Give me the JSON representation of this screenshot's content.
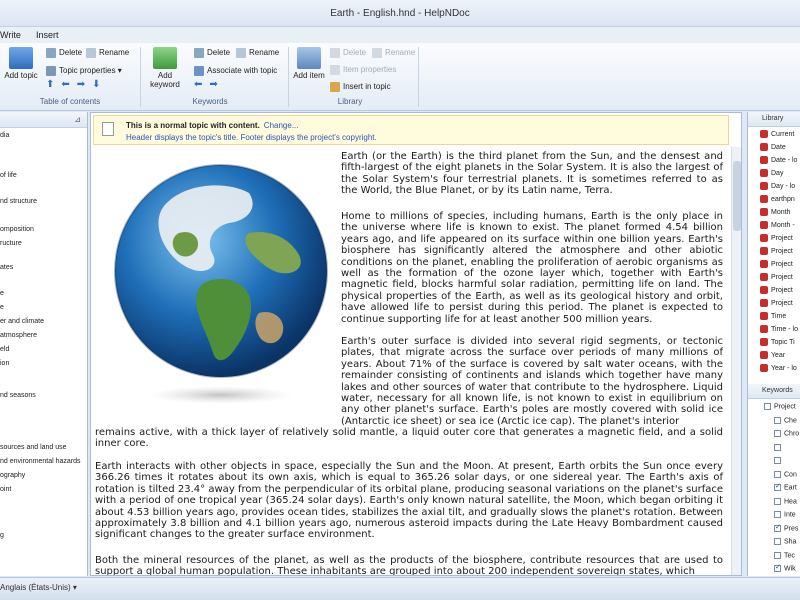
{
  "window": {
    "title": "Earth - English.hnd - HelpNDoc"
  },
  "menu": [
    "Write",
    "Insert"
  ],
  "ribbon": {
    "toc_group": {
      "label": "Table of contents",
      "add_topic": "Add topic",
      "delete": "Delete",
      "rename": "Rename",
      "topic_properties": "Topic properties"
    },
    "keywords_group": {
      "label": "Keywords",
      "add_keyword": "Add keyword",
      "delete": "Delete",
      "rename": "Rename",
      "associate": "Associate with topic"
    },
    "library_group": {
      "label": "Library",
      "add_item": "Add item",
      "delete": "Delete",
      "rename": "Rename",
      "item_properties": "Item properties",
      "insert_in_topic": "Insert in topic"
    }
  },
  "toc_items": [
    "dia",
    "of life",
    "nd structure",
    "omposition",
    "ructure",
    "ates",
    "e",
    "e",
    "er and climate",
    "atmosphere",
    "eld",
    "ion",
    "nd seasons",
    "sources and land use",
    "nd environmental hazards",
    "ography",
    "oint",
    "g"
  ],
  "editor": {
    "info_title": "This is a normal topic with content.",
    "info_link": "Change...",
    "info_desc": "Header displays the topic's title.  Footer displays the project's copyright."
  },
  "paragraphs": [
    "Earth (or the Earth) is the third planet from the Sun, and the densest and fifth-largest of the eight planets in the Solar System. It is also the largest of the Solar System's four terrestrial planets. It is sometimes referred to as the World, the Blue Planet, or by its Latin name, Terra.",
    "Home to millions of species, including humans, Earth is the only place in the universe where life is known to exist. The planet formed 4.54 billion years ago, and life appeared on its surface within one billion years. Earth's biosphere has significantly altered the atmosphere and other abiotic conditions on the planet, enabling the proliferation of aerobic organisms as well as the formation of the ozone layer which, together with Earth's magnetic field, blocks harmful solar radiation, permitting life on land. The physical properties of the Earth, as well as its geological history and orbit, have allowed life to persist during this period. The planet is expected to continue supporting life for at least another 500 million years.",
    "Earth's outer surface is divided into several rigid segments, or tectonic plates, that migrate across the surface over periods of many millions of years. About 71% of the surface is covered by salt water oceans, with the remainder consisting of continents and islands which together have many lakes and other sources of water that contribute to the hydrosphere. Liquid water, necessary for all known life, is not known to exist in equilibrium on any other planet's surface. Earth's poles are mostly covered with solid ice (Antarctic ice sheet) or sea ice (Arctic ice cap). The planet's interior",
    "remains active, with a thick layer of relatively solid mantle, a liquid outer core that generates a magnetic field, and a solid inner core.",
    "Earth interacts with other objects in space, especially the Sun and the Moon. At present, Earth orbits the Sun once every 366.26 times it rotates about its own axis, which is equal to 365.26 solar days, or one sidereal year. The Earth's axis of rotation is tilted 23.4° away from the perpendicular of its orbital plane, producing seasonal variations on the planet's surface with a period of one tropical year (365.24 solar days). Earth's only known natural satellite, the Moon, which began orbiting it about 4.53 billion years ago, provides ocean tides, stabilizes the axial tilt, and gradually slows the planet's rotation. Between approximately 3.8 billion and 4.1 billion years ago, numerous asteroid impacts during the Late Heavy Bombardment caused significant changes to the greater surface environment.",
    "Both the mineral resources of the planet, as well as the products of the biosphere, contribute resources that are used to support a global human population. These inhabitants are grouped into about 200 independent sovereign states, which"
  ],
  "library": {
    "title": "Library",
    "items": [
      "Current",
      "Date",
      "Date - lo",
      "Day",
      "Day - lo",
      "earthpn",
      "Month",
      "Month -",
      "Project",
      "Project",
      "Project",
      "Project",
      "Project",
      "Project",
      "Time",
      "Time - lo",
      "Topic Ti",
      "Year",
      "Year - lo"
    ]
  },
  "keywords": {
    "title": "Keywords",
    "items": [
      {
        "label": "Project",
        "checked": false
      },
      {
        "label": "Che",
        "checked": false
      },
      {
        "label": "Chro",
        "checked": false
      },
      {
        "label": "",
        "checked": false
      },
      {
        "label": "",
        "checked": false
      },
      {
        "label": "Con",
        "checked": false
      },
      {
        "label": "Eart",
        "checked": true
      },
      {
        "label": "Hea",
        "checked": false
      },
      {
        "label": "Inte",
        "checked": false
      },
      {
        "label": "Pres",
        "checked": true
      },
      {
        "label": "Sha",
        "checked": false
      },
      {
        "label": "Tec",
        "checked": false
      },
      {
        "label": "Wik",
        "checked": true
      }
    ]
  },
  "status": {
    "language": "Anglais (États-Unis)"
  },
  "colors": {
    "accent": "#2f55b5",
    "link": "#1f3ea8",
    "library_icon": "#c62d2d"
  }
}
